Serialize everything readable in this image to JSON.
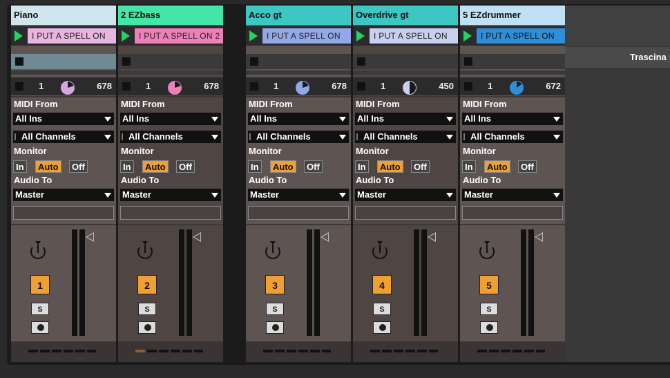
{
  "tracks": [
    {
      "name": "Piano",
      "color": "#cfe6ee",
      "clip": "I PUT A SPELL ON",
      "clip_color": "#e8b4e0",
      "slot_color": "#6f8a92",
      "count": "1",
      "value": "678",
      "pie_color": "#d7a5e0",
      "pie_pct": 80,
      "midi_from_label": "MIDI From",
      "input": "All Ins",
      "channel": "All Channels",
      "monitor_label": "Monitor",
      "mon_in": "In",
      "mon_auto": "Auto",
      "mon_off": "Off",
      "audio_to_label": "Audio To",
      "output": "Master",
      "arm": "1",
      "solo": "S",
      "meter_active": false
    },
    {
      "name": "2 EZbass",
      "color": "#43e6a6",
      "clip": "I PUT A SPELL ON 2",
      "clip_color": "#ee80b8",
      "slot_color": "#3a3a3a",
      "count": "1",
      "value": "678",
      "pie_color": "#ee80b8",
      "pie_pct": 80,
      "midi_from_label": "MIDI From",
      "input": "All Ins",
      "channel": "All Channels",
      "monitor_label": "Monitor",
      "mon_in": "In",
      "mon_auto": "Auto",
      "mon_off": "Off",
      "audio_to_label": "Audio To",
      "output": "Master",
      "arm": "2",
      "solo": "S",
      "meter_active": true
    },
    {
      "name": "Acco gt",
      "color": "#3cc7c2",
      "clip": "I PUT A SPELL ON",
      "clip_color": "#93a8e8",
      "slot_color": "#3a3a3a",
      "count": "1",
      "value": "678",
      "pie_color": "#93a8e8",
      "pie_pct": 80,
      "midi_from_label": "MIDI From",
      "input": "All Ins",
      "channel": "All Channels",
      "monitor_label": "Monitor",
      "mon_in": "In",
      "mon_auto": "Auto",
      "mon_off": "Off",
      "audio_to_label": "Audio To",
      "output": "Master",
      "arm": "3",
      "solo": "S",
      "meter_active": false
    },
    {
      "name": "Overdrive gt",
      "color": "#3cc7c2",
      "clip": "I PUT A SPELL ON",
      "clip_color": "#c8d0f0",
      "slot_color": "#3a3a3a",
      "count": "1",
      "value": "450",
      "pie_color": "#c8d0f0",
      "pie_pct": 50,
      "midi_from_label": "MIDI From",
      "input": "All Ins",
      "channel": "All Channels",
      "monitor_label": "Monitor",
      "mon_in": "In",
      "mon_auto": "Auto",
      "mon_off": "Off",
      "audio_to_label": "Audio To",
      "output": "Master",
      "arm": "4",
      "solo": "S",
      "meter_active": false
    },
    {
      "name": "5 EZdrummer",
      "color": "#bfe0f5",
      "clip": "I PUT A SPELL ON",
      "clip_color": "#2e8fd8",
      "slot_color": "#3a3a3a",
      "count": "1",
      "value": "672",
      "pie_color": "#2e8fd8",
      "pie_pct": 85,
      "midi_from_label": "MIDI From",
      "input": "All Ins",
      "channel": "All Channels",
      "monitor_label": "Monitor",
      "mon_in": "In",
      "mon_auto": "Auto",
      "mon_off": "Off",
      "audio_to_label": "Audio To",
      "output": "Master",
      "arm": "5",
      "solo": "S",
      "meter_active": false
    }
  ],
  "right_panel": {
    "drop_label": "Trascina"
  }
}
